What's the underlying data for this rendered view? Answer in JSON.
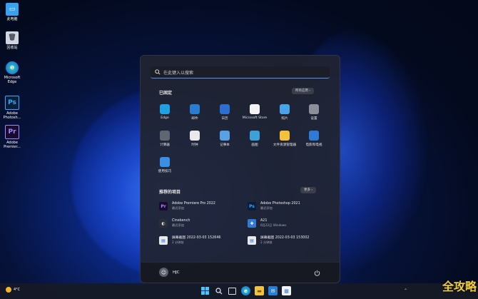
{
  "desktop": {
    "items": [
      {
        "label": "此电脑",
        "icon": "computer-icon"
      },
      {
        "label": "回收站",
        "icon": "recycle-bin-icon"
      },
      {
        "label": "Microsoft Edge",
        "icon": "edge-icon"
      },
      {
        "label": "Adobe Photosh...",
        "icon": "photoshop-icon"
      },
      {
        "label": "Adobe Premier...",
        "icon": "premiere-icon"
      }
    ]
  },
  "start_menu": {
    "search_placeholder": "在此键入以搜索",
    "pinned_title": "已固定",
    "all_apps_label": "所有应用  ›",
    "pinned": [
      {
        "label": "Edge",
        "icon": "edge-icon",
        "color": "#1fa0e0"
      },
      {
        "label": "邮件",
        "icon": "mail-icon",
        "color": "#2b7cd3"
      },
      {
        "label": "日历",
        "icon": "calendar-icon",
        "color": "#2b6fd1"
      },
      {
        "label": "Microsoft Store",
        "icon": "store-icon",
        "color": "#f3f3f3"
      },
      {
        "label": "照片",
        "icon": "photos-icon",
        "color": "#4aa3e8"
      },
      {
        "label": "设置",
        "icon": "settings-icon",
        "color": "#8a8f99"
      },
      {
        "label": "计算器",
        "icon": "calculator-icon",
        "color": "#606672"
      },
      {
        "label": "时钟",
        "icon": "clock-icon",
        "color": "#e9e9e9"
      },
      {
        "label": "记事本",
        "icon": "notepad-icon",
        "color": "#5aa0e6"
      },
      {
        "label": "画图",
        "icon": "paint-icon",
        "color": "#3fa0d8"
      },
      {
        "label": "文件资源管理器",
        "icon": "folder-icon",
        "color": "#f2c23c"
      },
      {
        "label": "电影和电视",
        "icon": "movies-icon",
        "color": "#2f7ad6"
      },
      {
        "label": "使用技巧",
        "icon": "tips-icon",
        "color": "#3a8ee6"
      }
    ],
    "recommended_title": "推荐的项目",
    "more_label": "更多  ›",
    "recommended": [
      {
        "title": "Adobe Premiere Pro 2022",
        "subtitle": "最近添加",
        "icon": "premiere-icon",
        "badge": "Pr"
      },
      {
        "title": "Adobe Photoshop 2021",
        "subtitle": "最近添加",
        "icon": "photoshop-icon",
        "badge": "Ps"
      },
      {
        "title": "Cinebench",
        "subtitle": "最近添加",
        "icon": "cinebench-icon",
        "badge": "◐"
      },
      {
        "title": "A21",
        "subtitle": "6月22日 Windows",
        "icon": "file-icon",
        "badge": "✚"
      },
      {
        "title": "屏幕截图 2022-03-03 152646",
        "subtitle": "2 分钟前",
        "icon": "image-file-icon",
        "badge": "▤"
      },
      {
        "title": "屏幕截图 2022-03-03 153002",
        "subtitle": "2 分钟前",
        "icon": "image-file-icon",
        "badge": "▤"
      }
    ],
    "user_name": "HJC"
  },
  "taskbar": {
    "weather_temp": "4°C",
    "watermark": "全攻略"
  }
}
